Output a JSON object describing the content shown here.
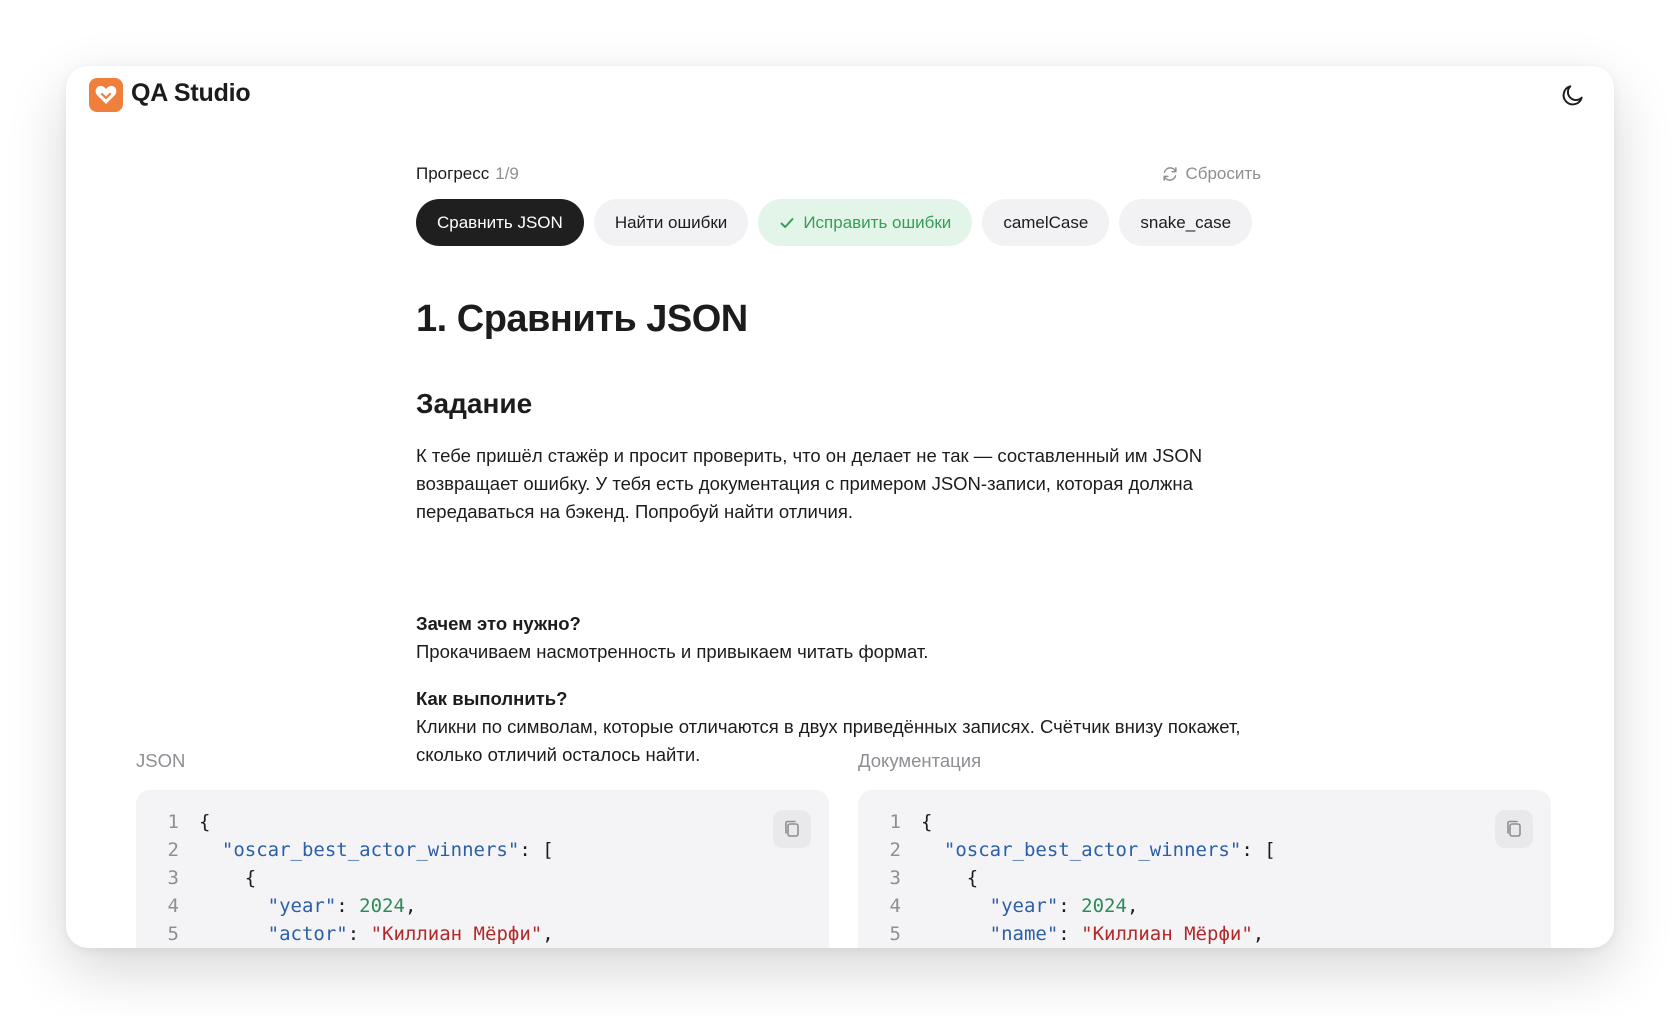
{
  "app": {
    "title": "QA Studio",
    "logo_icon": "heart-icon",
    "brand_color": "#f07f3c"
  },
  "header": {
    "theme_toggle_icon": "moon-icon"
  },
  "progress": {
    "label": "Прогресс",
    "count": "1/9",
    "reset_label": "Сбросить",
    "reset_icon": "refresh-icon"
  },
  "tabs": [
    {
      "label": "Сравнить JSON",
      "state": "active"
    },
    {
      "label": "Найти ошибки",
      "state": "default"
    },
    {
      "label": "Исправить ошибки",
      "state": "done"
    },
    {
      "label": "camelCase",
      "state": "default"
    },
    {
      "label": "snake_case",
      "state": "default"
    }
  ],
  "lesson": {
    "title": "1. Сравнить JSON",
    "task_heading": "Задание",
    "task_text": "К тебе пришёл стажёр и просит проверить, что он делает не так — составленный им JSON возвращает ошибку. У тебя есть документация с примером JSON-записи, которая должна передаваться на бэкенд. Попробуй найти отличия.",
    "why_heading": "Зачем это нужно?",
    "why_text": "Прокачиваем насмотренность и привыкаем читать формат.",
    "how_heading": "Как выполнить?",
    "how_text": "Кликни по символам, которые отличаются в двух приведённых записях. Счётчик внизу покажет, сколько отличий осталось найти."
  },
  "panels": {
    "json": {
      "label": "JSON",
      "lines": [
        {
          "n": "1",
          "tokens": [
            {
              "t": "p",
              "v": "{"
            }
          ]
        },
        {
          "n": "2",
          "tokens": [
            {
              "t": "p",
              "v": "  "
            },
            {
              "t": "key",
              "v": "\"oscar_best_actor_winners\""
            },
            {
              "t": "p",
              "v": ": ["
            }
          ]
        },
        {
          "n": "3",
          "tokens": [
            {
              "t": "p",
              "v": "    {"
            }
          ]
        },
        {
          "n": "4",
          "tokens": [
            {
              "t": "p",
              "v": "      "
            },
            {
              "t": "key",
              "v": "\"year\""
            },
            {
              "t": "p",
              "v": ": "
            },
            {
              "t": "num",
              "v": "2024"
            },
            {
              "t": "p",
              "v": ","
            }
          ]
        },
        {
          "n": "5",
          "tokens": [
            {
              "t": "p",
              "v": "      "
            },
            {
              "t": "key",
              "v": "\"actor\""
            },
            {
              "t": "p",
              "v": ": "
            },
            {
              "t": "str",
              "v": "\"Киллиан Мёрфи\""
            },
            {
              "t": "p",
              "v": ","
            }
          ]
        }
      ]
    },
    "docs": {
      "label": "Документация",
      "lines": [
        {
          "n": "1",
          "tokens": [
            {
              "t": "p",
              "v": "{"
            }
          ]
        },
        {
          "n": "2",
          "tokens": [
            {
              "t": "p",
              "v": "  "
            },
            {
              "t": "key",
              "v": "\"oscar_best_actor_winners\""
            },
            {
              "t": "p",
              "v": ": ["
            }
          ]
        },
        {
          "n": "3",
          "tokens": [
            {
              "t": "p",
              "v": "    {"
            }
          ]
        },
        {
          "n": "4",
          "tokens": [
            {
              "t": "p",
              "v": "      "
            },
            {
              "t": "key",
              "v": "\"year\""
            },
            {
              "t": "p",
              "v": ": "
            },
            {
              "t": "num",
              "v": "2024"
            },
            {
              "t": "p",
              "v": ","
            }
          ]
        },
        {
          "n": "5",
          "tokens": [
            {
              "t": "p",
              "v": "      "
            },
            {
              "t": "key",
              "v": "\"name\""
            },
            {
              "t": "p",
              "v": ": "
            },
            {
              "t": "str",
              "v": "\"Киллиан Мёрфи\""
            },
            {
              "t": "p",
              "v": ","
            }
          ]
        }
      ]
    }
  },
  "colors": {
    "tab_active_bg": "#1f1f1f",
    "tab_done_bg": "#e3f5e8",
    "tab_done_text": "#3a9b5c",
    "json_key": "#2b5fa8",
    "json_number": "#2e8b57",
    "json_string": "#b02a2a"
  },
  "copy_icon": "copy-icon"
}
